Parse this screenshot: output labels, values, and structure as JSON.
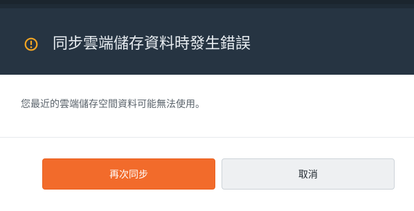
{
  "dialog": {
    "title": "同步雲端儲存資料時發生錯誤",
    "icon": "warning-circle-icon",
    "message": "您最近的雲端儲存空間資料可能無法使用。",
    "buttons": {
      "retry_label": "再次同步",
      "cancel_label": "取消"
    }
  },
  "colors": {
    "header_bg": "#263442",
    "icon_accent": "#f5a623",
    "primary_button": "#f26b2b",
    "secondary_button": "#eef0f2"
  }
}
